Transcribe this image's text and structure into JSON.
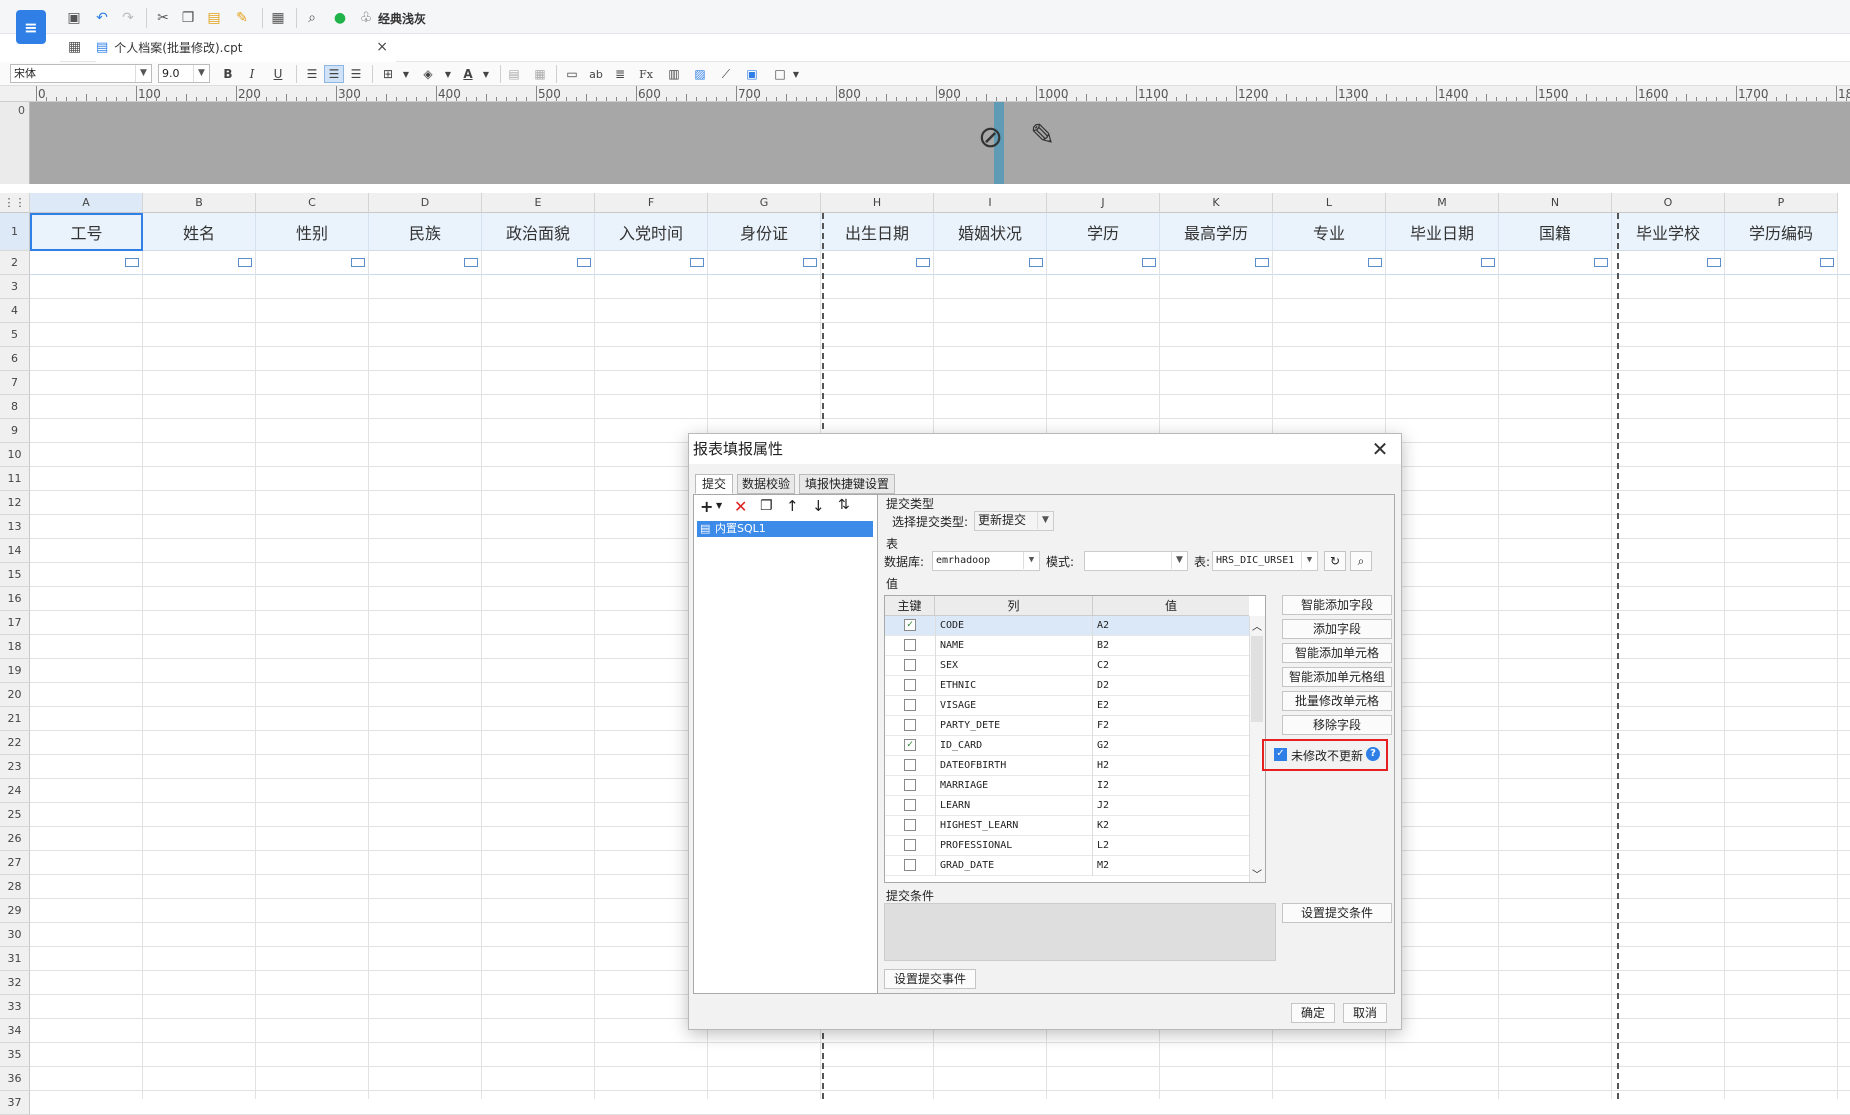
{
  "toolbar": {
    "classic_theme_label": "经典浅灰"
  },
  "file_tab": {
    "name": "个人档案(批量修改).cpt",
    "close": "×"
  },
  "format_bar": {
    "font_name": "宋体",
    "font_size": "9.0",
    "bold": "B",
    "italic": "I",
    "underline": "U"
  },
  "ruler": {
    "labels": [
      "0",
      "100",
      "200",
      "300",
      "400",
      "500",
      "600",
      "700",
      "800",
      "900",
      "1000",
      "1100",
      "1200",
      "1300",
      "1400",
      "1500",
      "1600",
      "1700",
      "18"
    ],
    "vertical_zero": "0"
  },
  "sheet": {
    "columns": [
      "A",
      "B",
      "C",
      "D",
      "E",
      "F",
      "G",
      "H",
      "I",
      "J",
      "K",
      "L",
      "M",
      "N",
      "O",
      "P"
    ],
    "headers": [
      "工号",
      "姓名",
      "性别",
      "民族",
      "政治面貌",
      "入党时间",
      "身份证",
      "出生日期",
      "婚姻状况",
      "学历",
      "最高学历",
      "专业",
      "毕业日期",
      "国籍",
      "毕业学校",
      "学历编码"
    ],
    "rows": [
      "1",
      "2",
      "3",
      "4",
      "5",
      "6",
      "7",
      "8",
      "9",
      "10",
      "11",
      "12",
      "13",
      "14",
      "15",
      "16",
      "17",
      "18",
      "19",
      "20",
      "21",
      "22",
      "23",
      "24",
      "25",
      "26",
      "27",
      "28",
      "29",
      "30",
      "31",
      "32",
      "33",
      "34",
      "35",
      "36",
      "37"
    ]
  },
  "dialog": {
    "title": "报表填报属性",
    "close": "✕",
    "tabs": [
      "提交",
      "数据校验",
      "填报快捷键设置"
    ],
    "tree_item": "内置SQL1",
    "submit_type_group": "提交类型",
    "select_submit_type_label": "选择提交类型:",
    "submit_type_value": "更新提交",
    "table_group": "表",
    "database_label": "数据库:",
    "database_value": "emrhadoop",
    "schema_label": "模式:",
    "schema_value": "",
    "table_label": "表:",
    "table_value": "HRS_DIC_URSE1",
    "value_group": "值",
    "col_headers": [
      "主键",
      "列",
      "值"
    ],
    "fields": [
      {
        "key": true,
        "column": "CODE",
        "value": "A2"
      },
      {
        "key": false,
        "column": "NAME",
        "value": "B2"
      },
      {
        "key": false,
        "column": "SEX",
        "value": "C2"
      },
      {
        "key": false,
        "column": "ETHNIC",
        "value": "D2"
      },
      {
        "key": false,
        "column": "VISAGE",
        "value": "E2"
      },
      {
        "key": false,
        "column": "PARTY_DETE",
        "value": "F2"
      },
      {
        "key": true,
        "column": "ID_CARD",
        "value": "G2"
      },
      {
        "key": false,
        "column": "DATEOFBIRTH",
        "value": "H2"
      },
      {
        "key": false,
        "column": "MARRIAGE",
        "value": "I2"
      },
      {
        "key": false,
        "column": "LEARN",
        "value": "J2"
      },
      {
        "key": false,
        "column": "HIGHEST_LEARN",
        "value": "K2"
      },
      {
        "key": false,
        "column": "PROFESSIONAL",
        "value": "L2"
      },
      {
        "key": false,
        "column": "GRAD_DATE",
        "value": "M2"
      }
    ],
    "side_buttons": [
      "智能添加字段",
      "添加字段",
      "智能添加单元格",
      "智能添加单元格组",
      "批量修改单元格",
      "移除字段"
    ],
    "no_update_label": "未修改不更新",
    "no_update_checked": true,
    "condition_group": "提交条件",
    "set_condition_button": "设置提交条件",
    "set_event_button": "设置提交事件",
    "ok_button": "确定",
    "cancel_button": "取消"
  }
}
